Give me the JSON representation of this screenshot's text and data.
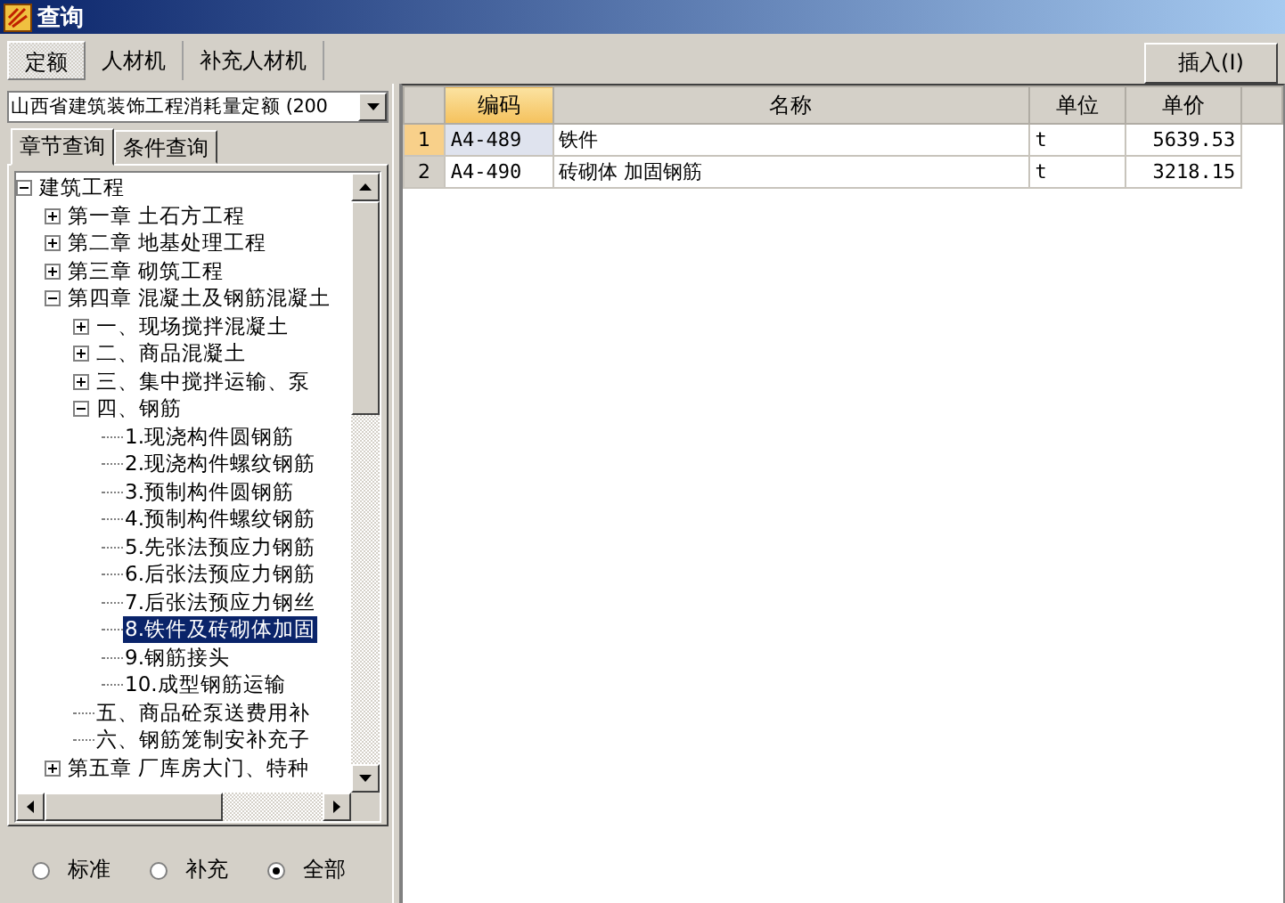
{
  "window": {
    "title": "查询"
  },
  "tabs": [
    {
      "label": "定额",
      "selected": true
    },
    {
      "label": "人材机",
      "selected": false
    },
    {
      "label": "补充人材机",
      "selected": false
    }
  ],
  "insert_button": "插入(I)",
  "library_select": {
    "value": "山西省建筑装饰工程消耗量定额 (200"
  },
  "sub_tabs": [
    {
      "label": "章节查询",
      "selected": true
    },
    {
      "label": "条件查询",
      "selected": false
    }
  ],
  "tree": [
    {
      "label": "建筑工程",
      "kind": "group",
      "expanded": true,
      "selected": false,
      "children": [
        {
          "label": "第一章  土石方工程",
          "kind": "group",
          "expanded": false,
          "selected": false
        },
        {
          "label": "第二章  地基处理工程",
          "kind": "group",
          "expanded": false,
          "selected": false
        },
        {
          "label": "第三章  砌筑工程",
          "kind": "group",
          "expanded": false,
          "selected": false
        },
        {
          "label": "第四章  混凝土及钢筋混凝土",
          "kind": "group",
          "expanded": true,
          "selected": false,
          "children": [
            {
              "label": "一、现场搅拌混凝土",
              "kind": "group",
              "expanded": false,
              "selected": false
            },
            {
              "label": "二、商品混凝土",
              "kind": "group",
              "expanded": false,
              "selected": false
            },
            {
              "label": "三、集中搅拌运输、泵",
              "kind": "group",
              "expanded": false,
              "selected": false
            },
            {
              "label": "四、钢筋",
              "kind": "group",
              "expanded": true,
              "selected": false,
              "children": [
                {
                  "label": "1.现浇构件圆钢筋",
                  "kind": "item",
                  "selected": false
                },
                {
                  "label": "2.现浇构件螺纹钢筋",
                  "kind": "item",
                  "selected": false
                },
                {
                  "label": "3.预制构件圆钢筋",
                  "kind": "item",
                  "selected": false
                },
                {
                  "label": "4.预制构件螺纹钢筋",
                  "kind": "item",
                  "selected": false
                },
                {
                  "label": "5.先张法预应力钢筋",
                  "kind": "item",
                  "selected": false
                },
                {
                  "label": "6.后张法预应力钢筋",
                  "kind": "item",
                  "selected": false
                },
                {
                  "label": "7.后张法预应力钢丝",
                  "kind": "item",
                  "selected": false
                },
                {
                  "label": "8.铁件及砖砌体加固",
                  "kind": "item",
                  "selected": true
                },
                {
                  "label": "9.钢筋接头",
                  "kind": "item",
                  "selected": false
                },
                {
                  "label": "10.成型钢筋运输",
                  "kind": "item",
                  "selected": false
                }
              ]
            },
            {
              "label": "五、商品砼泵送费用补",
              "kind": "item",
              "selected": false
            },
            {
              "label": "六、钢筋笼制安补充子",
              "kind": "item",
              "selected": false
            }
          ]
        },
        {
          "label": "第五章  厂库房大门、特种",
          "kind": "group",
          "expanded": false,
          "selected": false
        }
      ]
    }
  ],
  "filter_options": [
    {
      "label": "标准",
      "selected": false
    },
    {
      "label": "补充",
      "selected": false
    },
    {
      "label": "全部",
      "selected": true
    }
  ],
  "table": {
    "columns": [
      "编码",
      "名称",
      "单位",
      "单价"
    ],
    "rows": [
      {
        "index": "1",
        "cells": [
          "A4-489",
          "铁件",
          "t",
          "5639.53"
        ],
        "selected": true
      },
      {
        "index": "2",
        "cells": [
          "A4-490",
          "砖砌体  加固钢筋",
          "t",
          "3218.15"
        ],
        "selected": false
      }
    ]
  }
}
